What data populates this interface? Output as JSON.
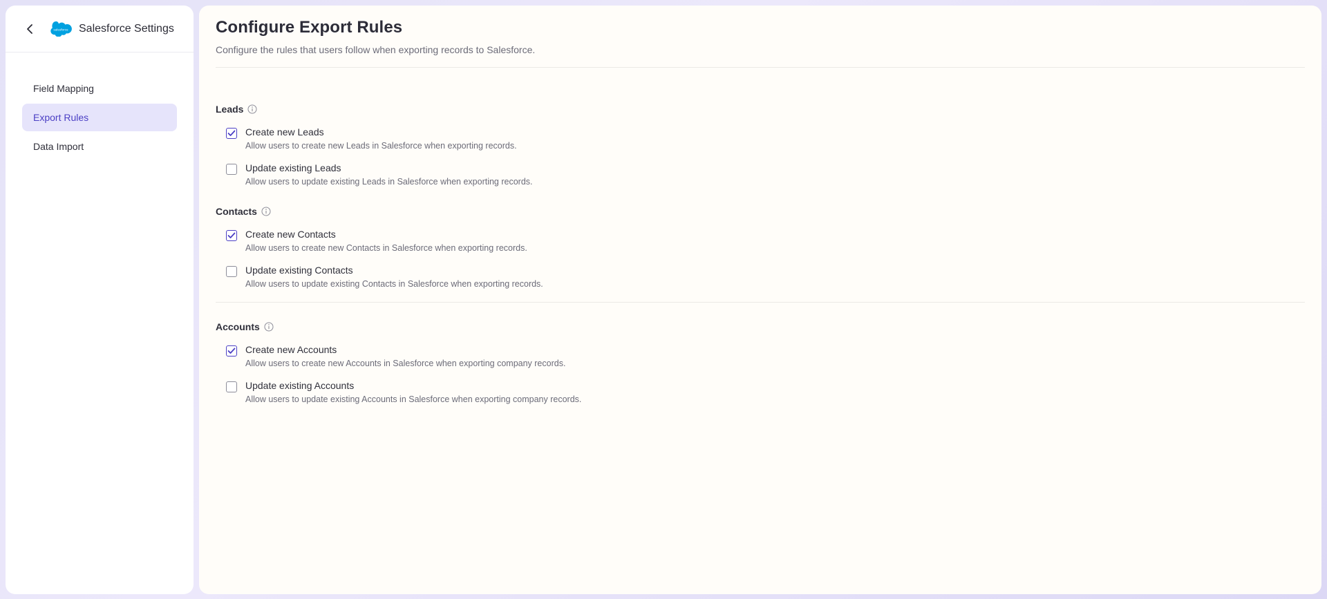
{
  "sidebar": {
    "title": "Salesforce Settings",
    "logo_text": "salesforce",
    "items": [
      {
        "label": "Field Mapping",
        "active": false
      },
      {
        "label": "Export Rules",
        "active": true
      },
      {
        "label": "Data Import",
        "active": false
      }
    ]
  },
  "page": {
    "title": "Configure Export Rules",
    "subtitle": "Configure the rules that users follow when exporting records to Salesforce."
  },
  "sections": [
    {
      "label": "Leads",
      "rules": [
        {
          "title": "Create new Leads",
          "desc": "Allow users to create new Leads in Salesforce when exporting records.",
          "checked": true
        },
        {
          "title": "Update existing Leads",
          "desc": "Allow users to update existing Leads in Salesforce when exporting records.",
          "checked": false
        }
      ]
    },
    {
      "label": "Contacts",
      "rules": [
        {
          "title": "Create new Contacts",
          "desc": "Allow users to create new Contacts in Salesforce when exporting records.",
          "checked": true
        },
        {
          "title": "Update existing Contacts",
          "desc": "Allow users to update existing Contacts in Salesforce when exporting records.",
          "checked": false
        }
      ]
    },
    {
      "label": "Accounts",
      "rules": [
        {
          "title": "Create new Accounts",
          "desc": "Allow users to create new Accounts in Salesforce when exporting company records.",
          "checked": true
        },
        {
          "title": "Update existing Accounts",
          "desc": "Allow users to update existing Accounts in Salesforce when exporting company records.",
          "checked": false
        }
      ]
    }
  ],
  "colors": {
    "accent": "#4b3fc4",
    "active_nav_bg": "#e6e4fb",
    "salesforce_blue": "#00a1e0"
  }
}
